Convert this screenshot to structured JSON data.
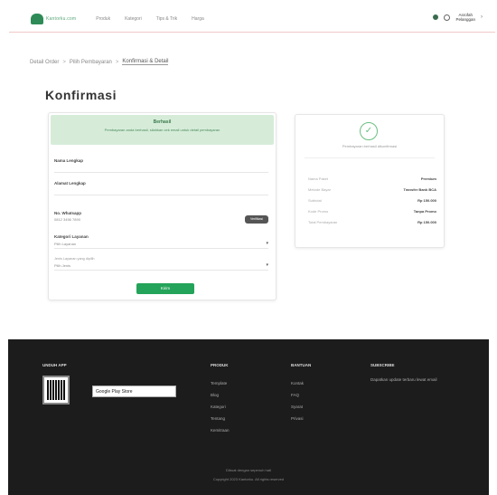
{
  "header": {
    "logo_text": "Kantorku.com",
    "nav": [
      "Produk",
      "Kategori",
      "Tips & Trik",
      "Harga"
    ],
    "user": {
      "name": "Asrofah",
      "sub": "Pelanggan"
    }
  },
  "breadcrumb": {
    "items": [
      "Detail Order",
      "Pilih Pembayaran",
      "Konfirmasi & Detail"
    ],
    "separator": ">"
  },
  "page_title": "Konfirmasi",
  "form": {
    "banner_title": "Berhasil",
    "banner_message": "Pembayaran anda berhasil, silahkan cek email untuk detail pembayaran",
    "fields": [
      {
        "label": "Nama Lengkap",
        "value": ""
      },
      {
        "label": "Alamat Lengkap",
        "value": ""
      }
    ],
    "phone": {
      "label": "No. Whatsapp",
      "value": "0812 3456 7890",
      "button": "Verifikasi"
    },
    "selects": [
      {
        "label": "Kategori Layanan",
        "note": "",
        "value": "Pilih Layanan"
      },
      {
        "label": "",
        "note": "Jenis Layanan yang dipilih",
        "value": "Pilih Jenis"
      }
    ],
    "submit_label": "Kirim"
  },
  "summary": {
    "note": "Pembayaran berhasil dikonfirmasi",
    "rows": [
      {
        "label": "Nama Paket",
        "value": "Premium"
      },
      {
        "label": "Metode Bayar",
        "value": "Transfer Bank BCA"
      },
      {
        "label": "Subtotal",
        "value": "Rp 150.000"
      },
      {
        "label": "Kode Promo",
        "value": "Tanpa Promo"
      },
      {
        "label": "Total Pembayaran",
        "value": "Rp 150.000"
      }
    ]
  },
  "footer": {
    "app_title": "UNDUH APP",
    "app_badge": "Google Play Store",
    "columns": [
      {
        "title": "PRODUK",
        "links": [
          "Template",
          "Blog",
          "Kategori",
          "Tentang",
          "Kemitraan"
        ]
      },
      {
        "title": "BANTUAN",
        "links": [
          "Kontak",
          "FAQ",
          "Syarat",
          "Privasi"
        ]
      }
    ],
    "subscribe_title": "SUBSCRIBE",
    "subscribe_text": "Dapatkan update terbaru lewat email",
    "bottom_line1": "Dibuat dengan sepenuh hati",
    "bottom_line2": "Copyright 2023 Kantorku. All rights reserved"
  },
  "colors": {
    "accent": "#24a35a",
    "banner_bg": "#d6ecd9",
    "footer_bg": "#1c1c1c"
  }
}
